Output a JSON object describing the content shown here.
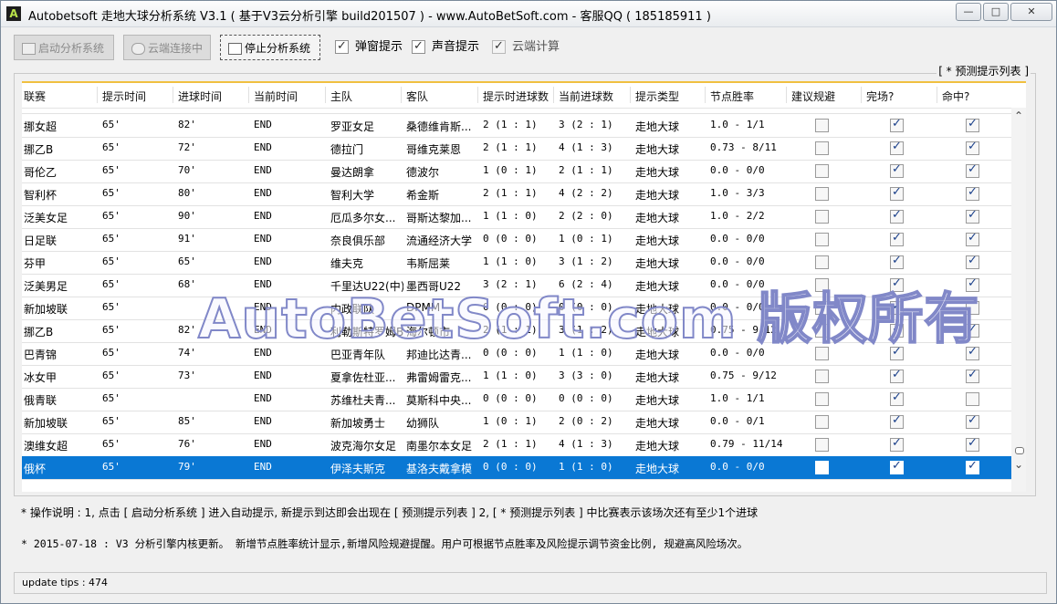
{
  "window": {
    "title": "Autobetsoft 走地大球分析系统 V3.1 ( 基于V3云分析引擎 build201507 ) - www.AutoBetSoft.com - 客服QQ ( 185185911 )",
    "min_glyph": "—",
    "max_glyph": "□",
    "close_glyph": "✕"
  },
  "toolbar": {
    "start_label": "启动分析系统",
    "cloud_label": "云端连接中",
    "stop_label": "停止分析系统",
    "popup_label": "弹窗提示",
    "sound_label": "声音提示",
    "cloud_calc_label": "云端计算"
  },
  "panel": {
    "caption": "[ * 预测提示列表 ]"
  },
  "columns": [
    "联赛",
    "提示时间",
    "进球时间",
    "当前时间",
    "主队",
    "客队",
    "提示时进球数",
    "当前进球数",
    "提示类型",
    "节点胜率",
    "建议规避",
    "完场?",
    "命中?"
  ],
  "rows": [
    {
      "league": "挪女超",
      "tip": "65'",
      "goal": "82'",
      "now": "END",
      "home": "罗亚女足",
      "away": "桑德维肯斯...",
      "tip_score": "2 (1 : 1)",
      "cur_score": "3 (2 : 1)",
      "type": "走地大球",
      "rate": "1.0 - 1/1",
      "avoid": false,
      "done": true,
      "hit": true
    },
    {
      "league": "挪乙B",
      "tip": "65'",
      "goal": "72'",
      "now": "END",
      "home": "德拉门",
      "away": "哥维克莱恩",
      "tip_score": "2 (1 : 1)",
      "cur_score": "4 (1 : 3)",
      "type": "走地大球",
      "rate": "0.73 - 8/11",
      "avoid": false,
      "done": true,
      "hit": true
    },
    {
      "league": "哥伦乙",
      "tip": "65'",
      "goal": "70'",
      "now": "END",
      "home": "曼达朗拿",
      "away": "德波尔",
      "tip_score": "1 (0 : 1)",
      "cur_score": "2 (1 : 1)",
      "type": "走地大球",
      "rate": "0.0 - 0/0",
      "avoid": false,
      "done": true,
      "hit": true
    },
    {
      "league": "智利杯",
      "tip": "65'",
      "goal": "80'",
      "now": "END",
      "home": "智利大学",
      "away": "希金斯",
      "tip_score": "2 (1 : 1)",
      "cur_score": "4 (2 : 2)",
      "type": "走地大球",
      "rate": "1.0 - 3/3",
      "avoid": false,
      "done": true,
      "hit": true
    },
    {
      "league": "泛美女足",
      "tip": "65'",
      "goal": "90'",
      "now": "END",
      "home": "厄瓜多尔女...",
      "away": "哥斯达黎加...",
      "tip_score": "1 (1 : 0)",
      "cur_score": "2 (2 : 0)",
      "type": "走地大球",
      "rate": "1.0 - 2/2",
      "avoid": false,
      "done": true,
      "hit": true
    },
    {
      "league": "日足联",
      "tip": "65'",
      "goal": "91'",
      "now": "END",
      "home": "奈良俱乐部",
      "away": "流通经济大学",
      "tip_score": "0 (0 : 0)",
      "cur_score": "1 (0 : 1)",
      "type": "走地大球",
      "rate": "0.0 - 0/0",
      "avoid": false,
      "done": true,
      "hit": true
    },
    {
      "league": "芬甲",
      "tip": "65'",
      "goal": "65'",
      "now": "END",
      "home": "维夫克",
      "away": "韦斯屈莱",
      "tip_score": "1 (1 : 0)",
      "cur_score": "3 (1 : 2)",
      "type": "走地大球",
      "rate": "0.0 - 0/0",
      "avoid": false,
      "done": true,
      "hit": true
    },
    {
      "league": "泛美男足",
      "tip": "65'",
      "goal": "68'",
      "now": "END",
      "home": "千里达U22(中)",
      "away": "墨西哥U22",
      "tip_score": "3 (2 : 1)",
      "cur_score": "6 (2 : 4)",
      "type": "走地大球",
      "rate": "0.0 - 0/0",
      "avoid": false,
      "done": true,
      "hit": true
    },
    {
      "league": "新加坡联",
      "tip": "65'",
      "goal": "",
      "now": "END",
      "home": "内政联队",
      "away": "DPMM",
      "tip_score": "0 (0 : 0)",
      "cur_score": "0 (0 : 0)",
      "type": "走地大球",
      "rate": "0.0 - 0/0",
      "avoid": false,
      "done": true,
      "hit": false
    },
    {
      "league": "挪乙B",
      "tip": "65'",
      "goal": "82'",
      "now": "END",
      "home": "利勒斯特罗姆B",
      "away": "海尔顿市",
      "tip_score": "2 (1 : 1)",
      "cur_score": "3 (1 : 2)",
      "type": "走地大球",
      "rate": "0.75 - 9/12",
      "avoid": false,
      "done": true,
      "hit": true
    },
    {
      "league": "巴青锦",
      "tip": "65'",
      "goal": "74'",
      "now": "END",
      "home": "巴亚青年队",
      "away": "邦迪比达青...",
      "tip_score": "0 (0 : 0)",
      "cur_score": "1 (1 : 0)",
      "type": "走地大球",
      "rate": "0.0 - 0/0",
      "avoid": false,
      "done": true,
      "hit": true
    },
    {
      "league": "冰女甲",
      "tip": "65'",
      "goal": "73'",
      "now": "END",
      "home": "夏拿佐杜亚...",
      "away": "弗雷姆雷克...",
      "tip_score": "1 (1 : 0)",
      "cur_score": "3 (3 : 0)",
      "type": "走地大球",
      "rate": "0.75 - 9/12",
      "avoid": false,
      "done": true,
      "hit": true
    },
    {
      "league": "俄青联",
      "tip": "65'",
      "goal": "",
      "now": "END",
      "home": "苏维杜夫青...",
      "away": "莫斯科中央...",
      "tip_score": "0 (0 : 0)",
      "cur_score": "0 (0 : 0)",
      "type": "走地大球",
      "rate": "1.0 - 1/1",
      "avoid": false,
      "done": true,
      "hit": false
    },
    {
      "league": "新加坡联",
      "tip": "65'",
      "goal": "85'",
      "now": "END",
      "home": "新加坡勇士",
      "away": "幼狮队",
      "tip_score": "1 (0 : 1)",
      "cur_score": "2 (0 : 2)",
      "type": "走地大球",
      "rate": "0.0 - 0/1",
      "avoid": false,
      "done": true,
      "hit": true
    },
    {
      "league": "澳维女超",
      "tip": "65'",
      "goal": "76'",
      "now": "END",
      "home": "波克海尔女足",
      "away": "南墨尔本女足",
      "tip_score": "2 (1 : 1)",
      "cur_score": "4 (1 : 3)",
      "type": "走地大球",
      "rate": "0.79 - 11/14",
      "avoid": false,
      "done": true,
      "hit": true
    },
    {
      "league": "俄杯",
      "tip": "65'",
      "goal": "79'",
      "now": "END",
      "home": "伊泽夫斯克",
      "away": "基洛夫戴拿模",
      "tip_score": "0 (0 : 0)",
      "cur_score": "1 (1 : 0)",
      "type": "走地大球",
      "rate": "0.0 - 0/0",
      "avoid": false,
      "done": true,
      "hit": true,
      "selected": true
    }
  ],
  "notes": {
    "usage": "* 操作说明 : 1, 点击 [ 启动分析系统 ] 进入自动提示, 新提示到达即会出现在 [ 预测提示列表 ] 2, [ * 预测提示列表 ] 中比赛表示该场次还有至少1个进球",
    "update": "* 2015-07-18 :  V3 分析引擎内核更新。 新增节点胜率统计显示,新增风险规避提醒。用户可根据节点胜率及风险提示调节资金比例, 规避高风险场次。"
  },
  "status": {
    "text": "update tips : 474"
  },
  "watermark": "AutoBetSoft.com 版权所有"
}
